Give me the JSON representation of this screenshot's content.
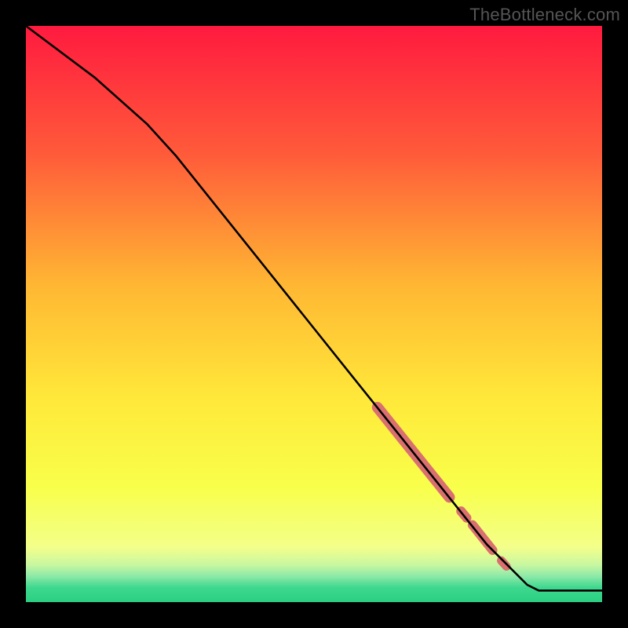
{
  "watermark": "TheBottleneck.com",
  "chart_data": {
    "type": "line",
    "title": "",
    "xlabel": "",
    "ylabel": "",
    "xlim": [
      0,
      1
    ],
    "ylim": [
      0,
      1
    ],
    "background_gradient": {
      "stops": [
        {
          "offset": 0.0,
          "color": "#ff1a3f"
        },
        {
          "offset": 0.22,
          "color": "#ff5a3a"
        },
        {
          "offset": 0.45,
          "color": "#ffb733"
        },
        {
          "offset": 0.65,
          "color": "#ffe93a"
        },
        {
          "offset": 0.8,
          "color": "#f8ff4a"
        },
        {
          "offset": 0.905,
          "color": "#f3ff8a"
        },
        {
          "offset": 0.935,
          "color": "#c9f7a1"
        },
        {
          "offset": 0.955,
          "color": "#8de9a8"
        },
        {
          "offset": 0.975,
          "color": "#3dd88e"
        },
        {
          "offset": 1.0,
          "color": "#2bcf82"
        }
      ]
    },
    "series": [
      {
        "name": "curve",
        "color": "#000000",
        "width": 2.6,
        "points": [
          {
            "x": 0.0,
            "y": 1.0
          },
          {
            "x": 0.12,
            "y": 0.91
          },
          {
            "x": 0.21,
            "y": 0.83
          },
          {
            "x": 0.26,
            "y": 0.775
          },
          {
            "x": 0.32,
            "y": 0.7
          },
          {
            "x": 0.4,
            "y": 0.6
          },
          {
            "x": 0.48,
            "y": 0.5
          },
          {
            "x": 0.56,
            "y": 0.4
          },
          {
            "x": 0.64,
            "y": 0.3
          },
          {
            "x": 0.72,
            "y": 0.2
          },
          {
            "x": 0.8,
            "y": 0.1
          },
          {
            "x": 0.87,
            "y": 0.03
          },
          {
            "x": 0.89,
            "y": 0.02
          },
          {
            "x": 1.0,
            "y": 0.02
          }
        ]
      }
    ],
    "highlights": {
      "color": "#d9706f",
      "segments": [
        {
          "x1": 0.61,
          "y1": 0.338,
          "x2": 0.735,
          "y2": 0.182,
          "width": 14
        },
        {
          "x1": 0.755,
          "y1": 0.158,
          "x2": 0.765,
          "y2": 0.146,
          "width": 12
        },
        {
          "x1": 0.775,
          "y1": 0.134,
          "x2": 0.81,
          "y2": 0.09,
          "width": 12
        },
        {
          "x1": 0.825,
          "y1": 0.072,
          "x2": 0.834,
          "y2": 0.062,
          "width": 11
        }
      ]
    }
  }
}
